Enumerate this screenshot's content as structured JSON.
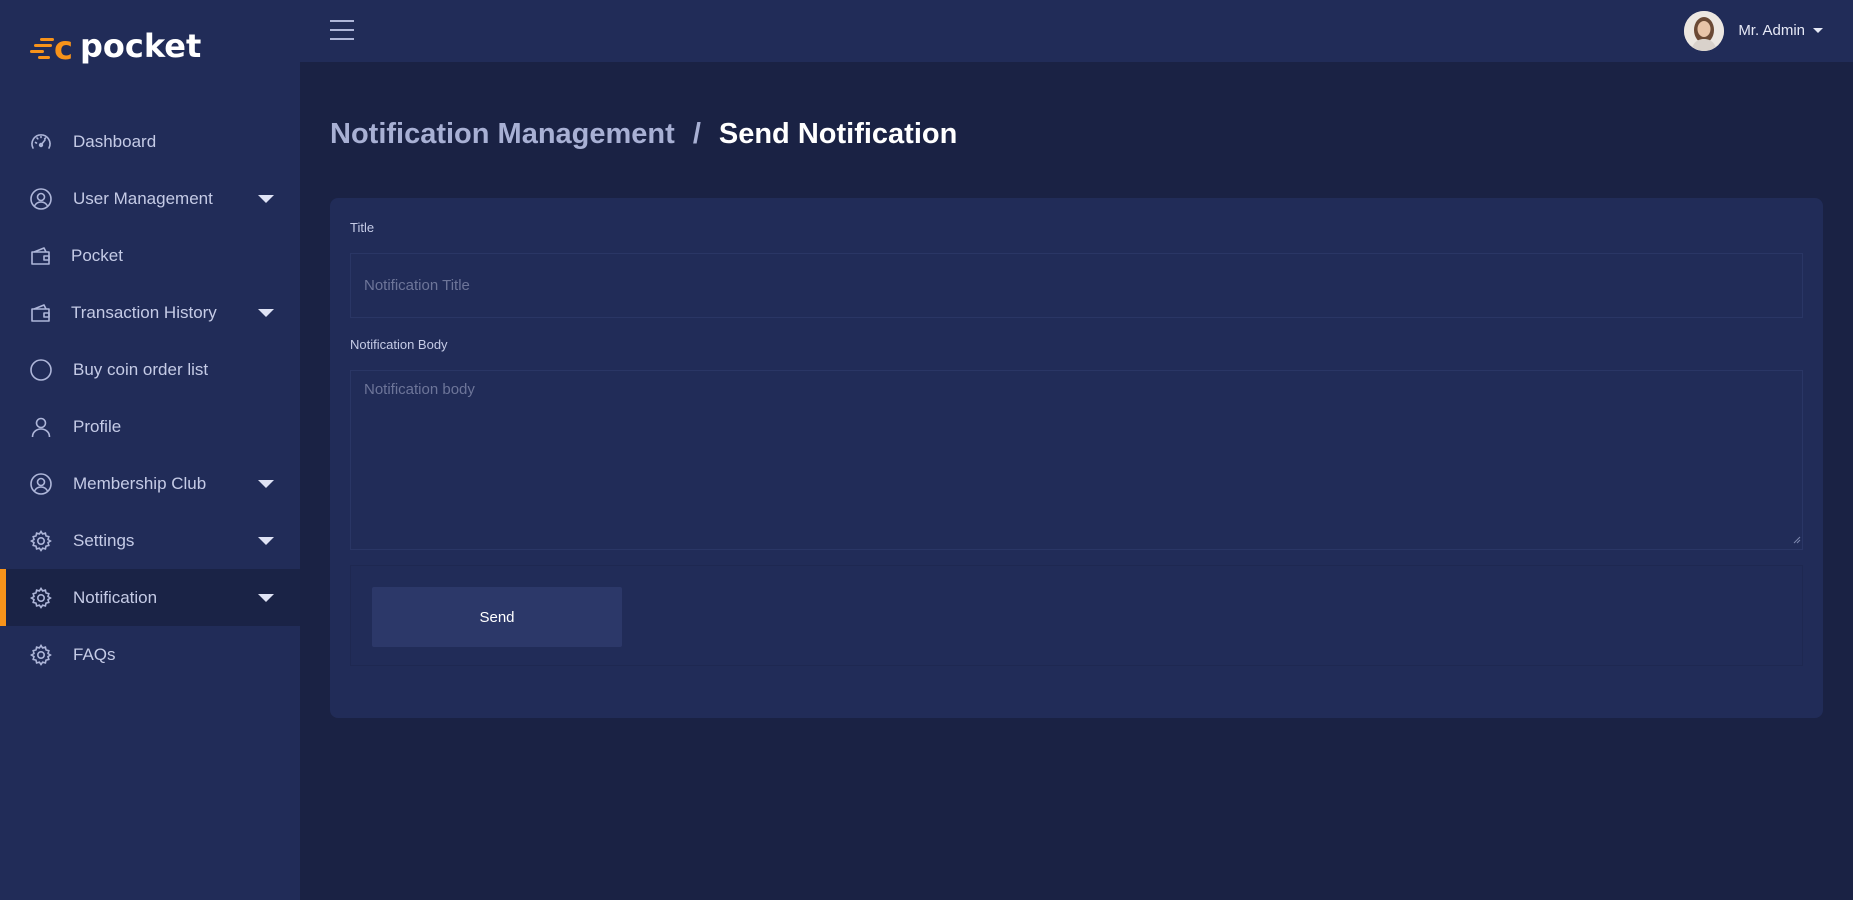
{
  "app": {
    "logo_text": "pocket",
    "logo_mark": "c",
    "accent_color": "#f7931a"
  },
  "sidebar": {
    "items": [
      {
        "label": "Dashboard",
        "icon": "speedometer-icon",
        "has_caret": false,
        "active": false
      },
      {
        "label": "User Management",
        "icon": "user-circle-icon",
        "has_caret": true,
        "active": false
      },
      {
        "label": "Pocket",
        "icon": "wallet-icon",
        "has_caret": false,
        "active": false
      },
      {
        "label": "Transaction History",
        "icon": "wallet-icon",
        "has_caret": true,
        "active": false
      },
      {
        "label": "Buy coin order list",
        "icon": "circle-icon",
        "has_caret": false,
        "active": false
      },
      {
        "label": "Profile",
        "icon": "user-icon",
        "has_caret": false,
        "active": false
      },
      {
        "label": "Membership Club",
        "icon": "user-circle-icon",
        "has_caret": true,
        "active": false
      },
      {
        "label": "Settings",
        "icon": "gear-icon",
        "has_caret": true,
        "active": false
      },
      {
        "label": "Notification",
        "icon": "gear-icon",
        "has_caret": true,
        "active": true
      },
      {
        "label": "FAQs",
        "icon": "gear-icon",
        "has_caret": false,
        "active": false
      }
    ]
  },
  "header": {
    "user_name": "Mr. Admin"
  },
  "breadcrumb": {
    "parent": "Notification Management",
    "separator": "/",
    "current": "Send Notification"
  },
  "form": {
    "title_label": "Title",
    "title_placeholder": "Notification Title",
    "title_value": "",
    "body_label": "Notification Body",
    "body_placeholder": "Notification body",
    "body_value": "",
    "send_label": "Send"
  }
}
